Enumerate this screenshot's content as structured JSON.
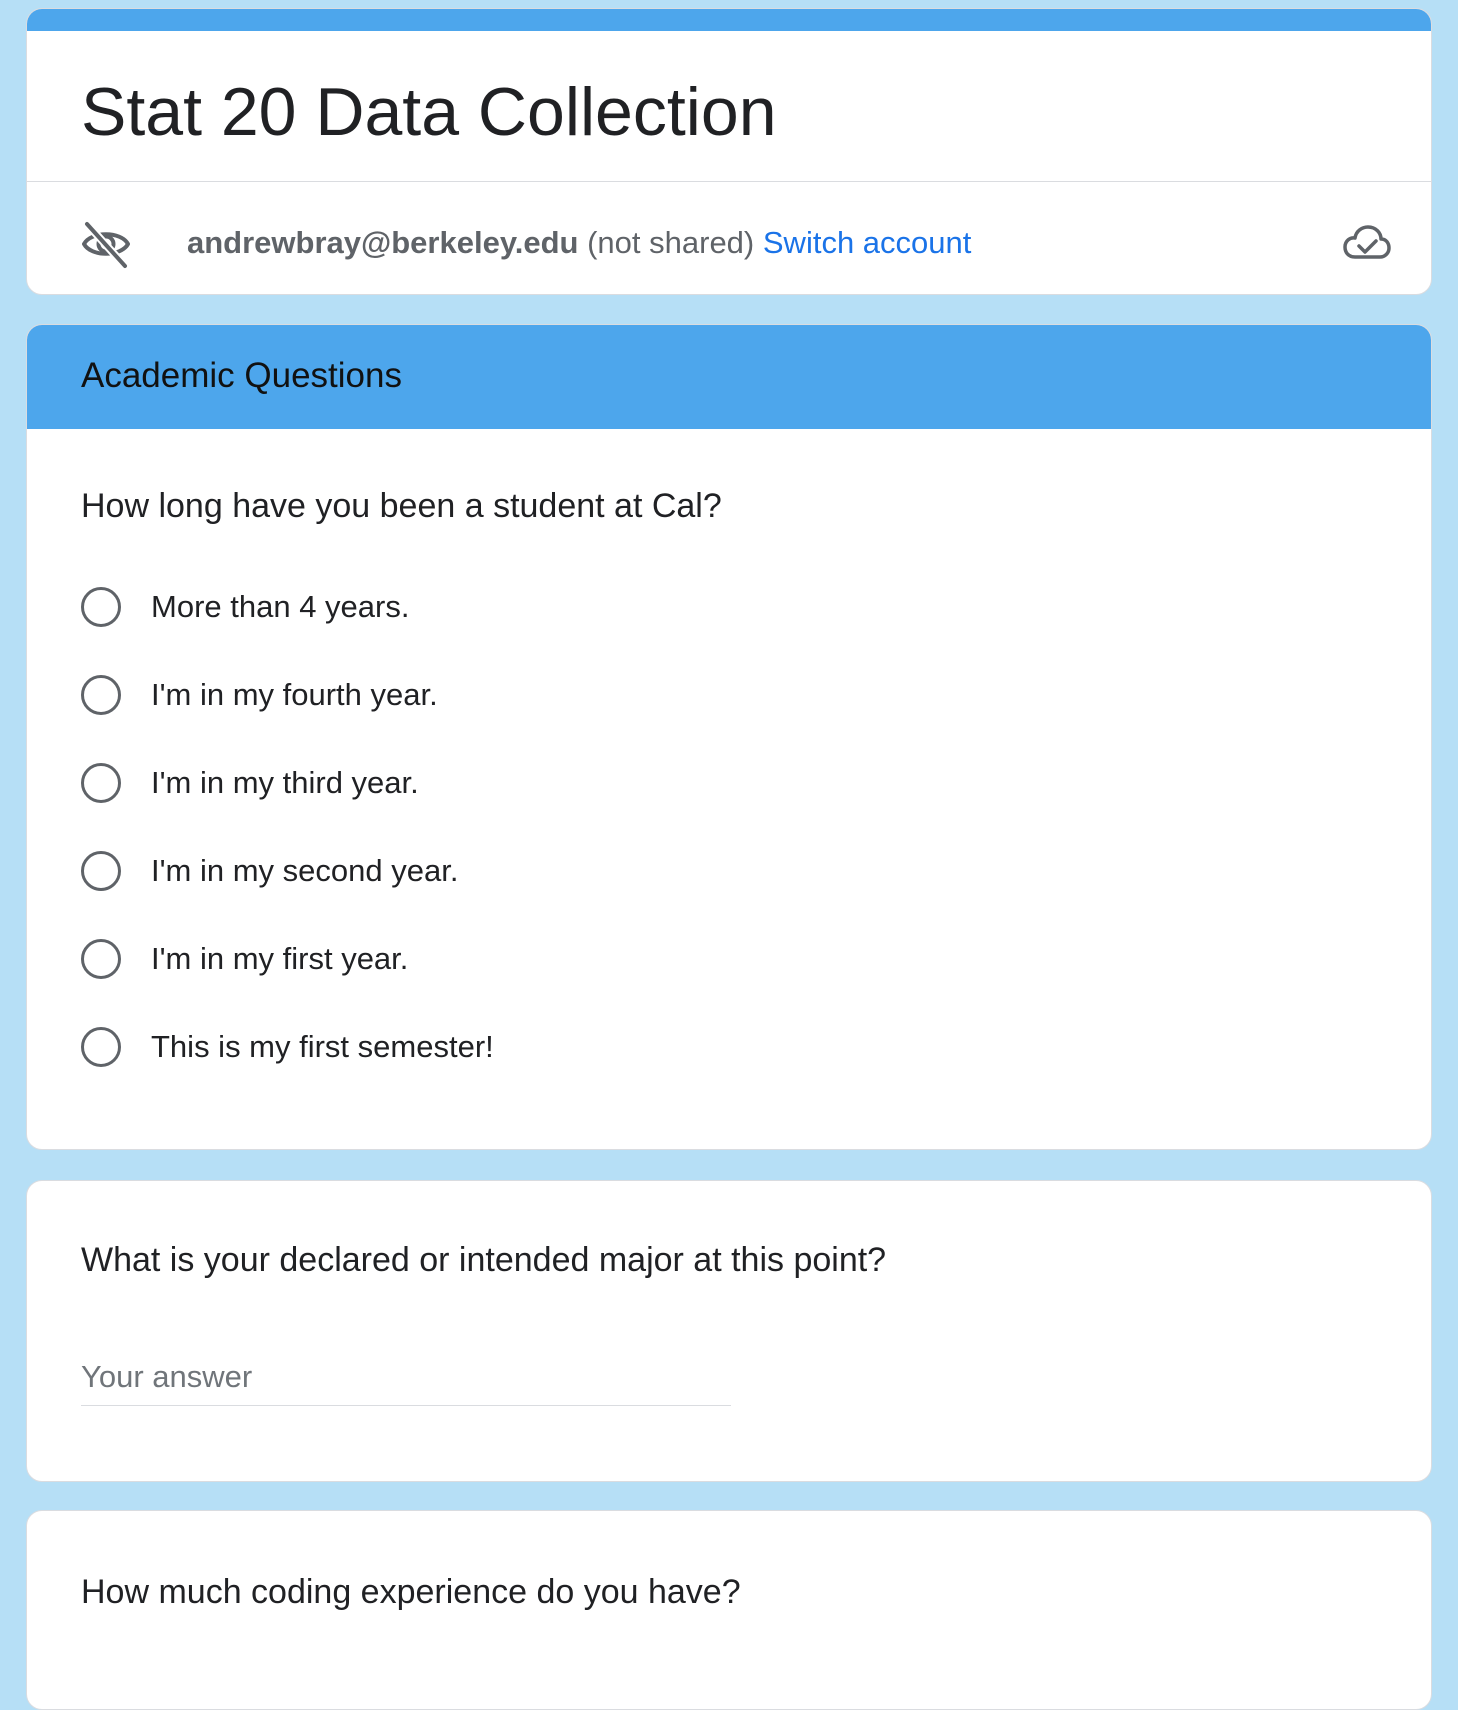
{
  "form": {
    "title": "Stat 20 Data Collection",
    "accent_color": "#4da6ec",
    "background_color": "#b6dff6"
  },
  "account": {
    "email": "andrewbray@berkeley.edu",
    "shared_status": "(not shared)",
    "switch_label": "Switch account",
    "visibility_icon": "eye-off-icon",
    "save_status_icon": "cloud-done-icon"
  },
  "section": {
    "title": "Academic Questions"
  },
  "questions": [
    {
      "title": "How long have you been a student at Cal?",
      "type": "radio",
      "options": [
        "More than 4 years.",
        "I'm in my fourth year.",
        "I'm in my third year.",
        "I'm in my second year.",
        "I'm in my first year.",
        "This is my first semester!"
      ]
    },
    {
      "title": "What is your declared or intended major at this point?",
      "type": "short-answer",
      "value": "",
      "placeholder": "Your answer"
    },
    {
      "title": "How much coding experience do you have?"
    }
  ]
}
